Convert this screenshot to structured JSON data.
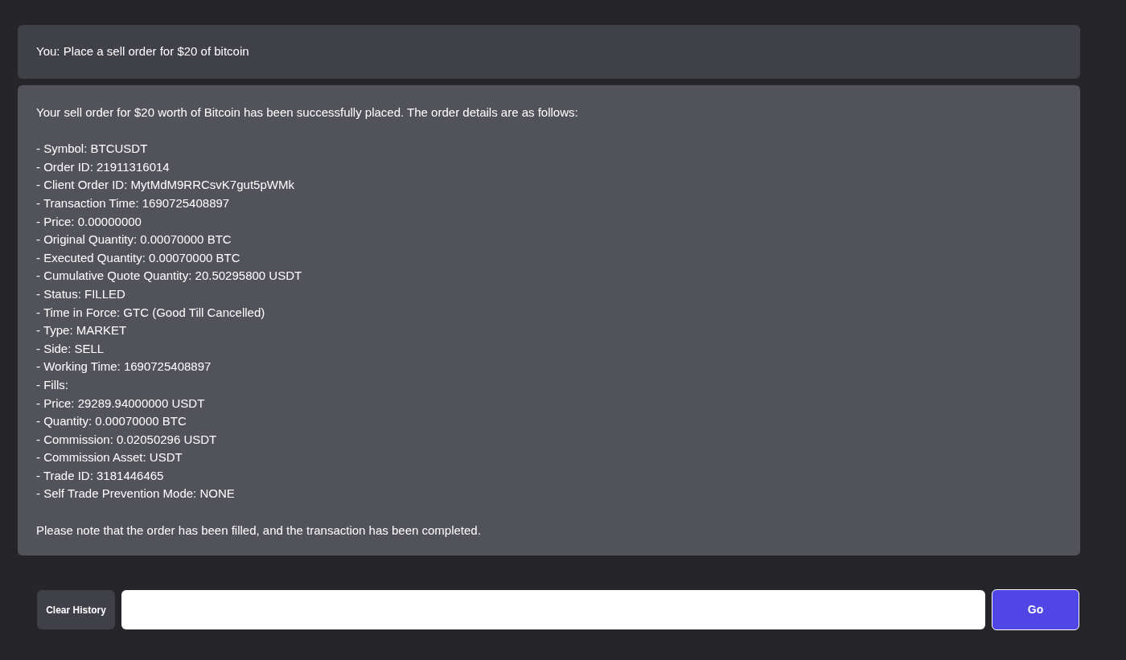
{
  "messages": [
    {
      "kind": "user",
      "text": "You: Place a sell order for $20 of bitcoin"
    },
    {
      "kind": "assistant",
      "intro": "Your sell order for $20 worth of Bitcoin has been successfully placed. The order details are as follows:",
      "lines": [
        "- Symbol: BTCUSDT",
        "- Order ID: 21911316014",
        "- Client Order ID: MytMdM9RRCsvK7gut5pWMk",
        "- Transaction Time: 1690725408897",
        "- Price: 0.00000000",
        "- Original Quantity: 0.00070000 BTC",
        "- Executed Quantity: 0.00070000 BTC",
        "- Cumulative Quote Quantity: 20.50295800 USDT",
        "- Status: FILLED",
        "- Time in Force: GTC (Good Till Cancelled)",
        "- Type: MARKET",
        "- Side: SELL",
        "- Working Time: 1690725408897",
        "- Fills:",
        "- Price: 29289.94000000 USDT",
        "- Quantity: 0.00070000 BTC",
        "- Commission: 0.02050296 USDT",
        "- Commission Asset: USDT",
        "- Trade ID: 3181446465",
        "- Self Trade Prevention Mode: NONE"
      ],
      "outro": "Please note that the order has been filled, and the transaction has been completed."
    }
  ],
  "composer": {
    "clear_button": "Clear History",
    "submit_button": "Go"
  }
}
